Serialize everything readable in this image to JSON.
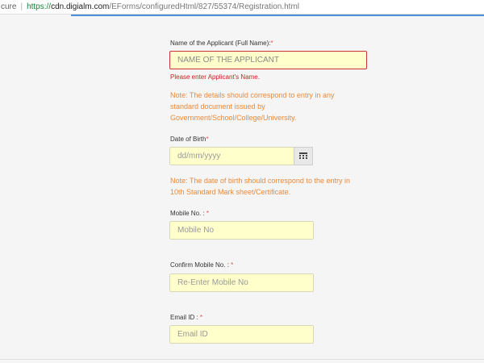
{
  "browser": {
    "security_text": "cure",
    "url_scheme": "https://",
    "url_host": "cdn.digialm.com",
    "url_path": "/EForms/configuredHtml/827/55374/Registration.html"
  },
  "form": {
    "applicant_name": {
      "label": "Name of the Applicant (Full Name):",
      "required_mark": "*",
      "placeholder": "NAME OF THE APPLICANT",
      "error": "Please enter Applicant's Name.",
      "note": "Note: The details should correspond to entry in any standard document issued by Government/School/College/University."
    },
    "dob": {
      "label": "Date of Birth",
      "required_mark": "*",
      "placeholder": "dd/mm/yyyy",
      "note": "Note: The date of birth should correspond to the entry in 10th Standard Mark sheet/Certificate."
    },
    "mobile": {
      "label": "Mobile No. : ",
      "required_mark": "*",
      "placeholder": "Mobile No"
    },
    "confirm_mobile": {
      "label": "Confirm Mobile No. : ",
      "required_mark": "*",
      "placeholder": "Re-Enter Mobile No"
    },
    "email": {
      "label": "Email ID : ",
      "required_mark": "*",
      "placeholder": "Email ID"
    }
  },
  "colors": {
    "input_bg": "#ffffcc",
    "error_border": "#cc3333",
    "note_text": "#e88a3c",
    "required": "#d9534f"
  },
  "icons": {
    "calendar_button": "calendar-icon"
  }
}
